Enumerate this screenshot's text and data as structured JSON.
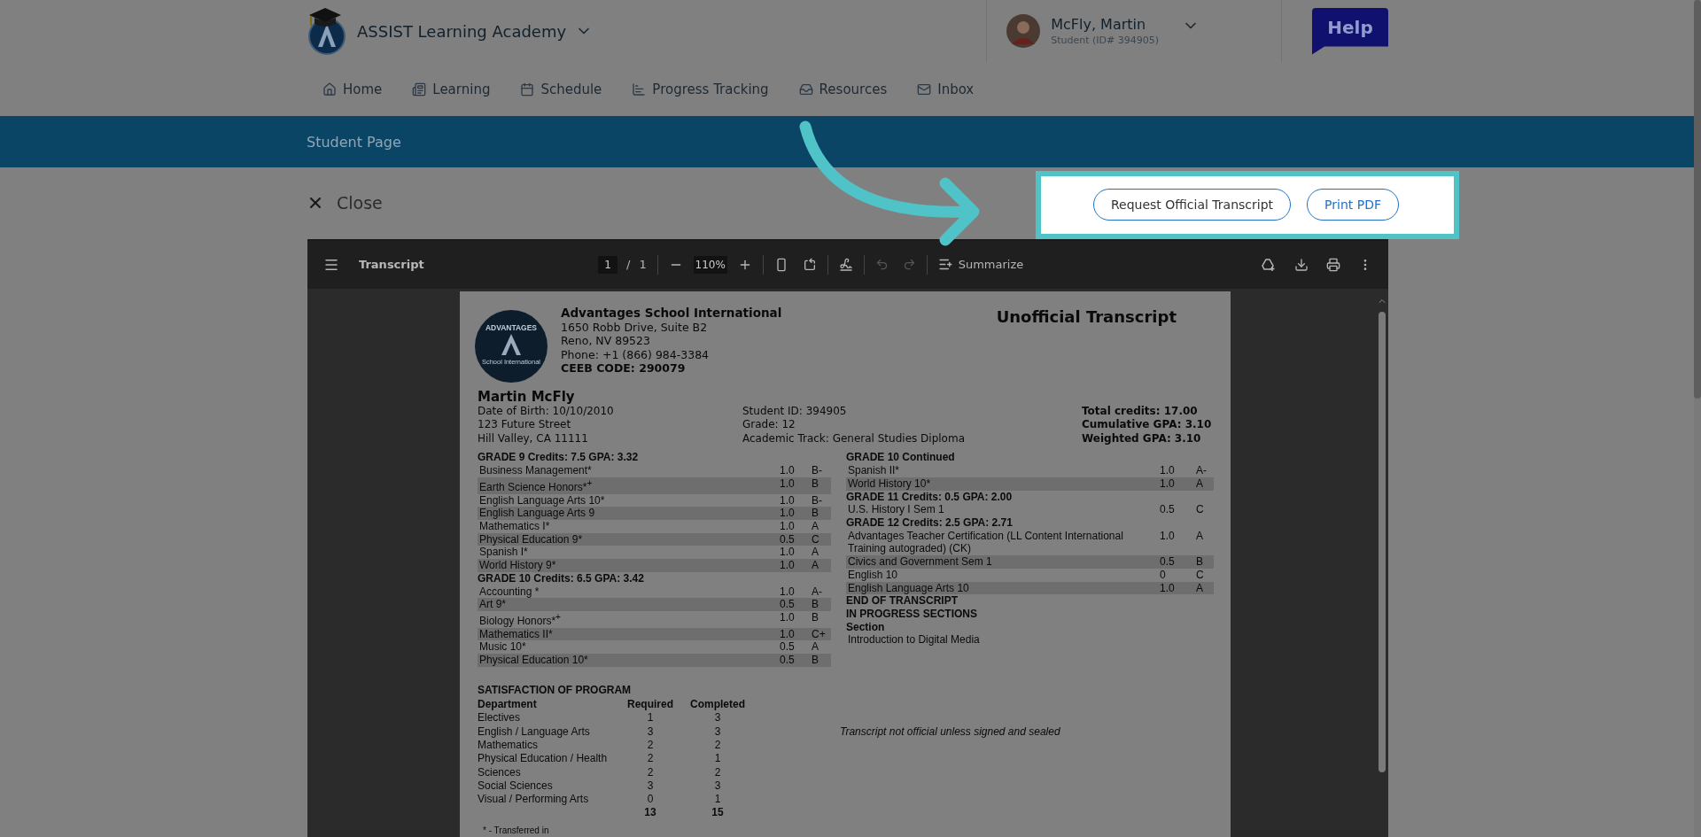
{
  "header": {
    "school": "ASSIST Learning Academy",
    "user": {
      "name": "McFly, Martin",
      "role": "Student (ID# 394905)"
    },
    "help": "Help"
  },
  "nav": [
    {
      "kind": "home",
      "label": "Home"
    },
    {
      "kind": "learning",
      "label": "Learning"
    },
    {
      "kind": "schedule",
      "label": "Schedule"
    },
    {
      "kind": "progress",
      "label": "Progress Tracking"
    },
    {
      "kind": "resources",
      "label": "Resources"
    },
    {
      "kind": "inbox",
      "label": "Inbox"
    }
  ],
  "banner": "Student Page",
  "close": "Close",
  "actions": [
    {
      "label": "Request Official Transcript",
      "primary": false
    },
    {
      "label": "Print PDF",
      "primary": true
    }
  ],
  "viewer": {
    "title": "Transcript",
    "page": "1",
    "separator": "/",
    "page_total": "1",
    "zoom": "110%",
    "summarize": "Summarize"
  },
  "document": {
    "seal": {
      "top": "ADVANTAGES",
      "bottom": "School International"
    },
    "school": {
      "name": "Advantages School International",
      "address": [
        "1650 Robb Drive, Suite B2",
        "Reno, NV 89523",
        "Phone: +1 (866) 984-3384"
      ],
      "code": "CEEB CODE: 290079"
    },
    "title": "Unofficial Transcript",
    "student": {
      "name": "Martin McFly",
      "details": [
        "Date of Birth: 10/10/2010",
        "123 Future Street",
        "Hill Valley, CA 11111"
      ],
      "ids": [
        "Student ID: 394905",
        "Grade: 12",
        "Academic Track: General Studies Diploma"
      ],
      "totals": [
        "Total credits: 17.00",
        "Cumulative GPA: 3.10",
        "Weighted GPA: 3.10"
      ]
    },
    "left_column": [
      {
        "kind": "heading",
        "text": "GRADE 9  Credits: 7.5  GPA: 3.32"
      },
      {
        "kind": "course",
        "name": "Business Management*",
        "credits": "1.0",
        "grade": "B-"
      },
      {
        "kind": "course",
        "name": "Earth Science Honors*$^{+}$",
        "credits": "1.0",
        "grade": "B"
      },
      {
        "kind": "course",
        "name": "English Language Arts 10*",
        "credits": "1.0",
        "grade": "B-"
      },
      {
        "kind": "course",
        "name": "English Language Arts 9",
        "credits": "1.0",
        "grade": "B"
      },
      {
        "kind": "course",
        "name": "Mathematics I*",
        "credits": "1.0",
        "grade": "A"
      },
      {
        "kind": "course",
        "name": "Physical Education 9*",
        "credits": "0.5",
        "grade": "C"
      },
      {
        "kind": "course",
        "name": "Spanish I*",
        "credits": "1.0",
        "grade": "A"
      },
      {
        "kind": "course",
        "name": "World History 9*",
        "credits": "1.0",
        "grade": "A"
      },
      {
        "kind": "heading",
        "text": "GRADE 10  Credits: 6.5  GPA: 3.42"
      },
      {
        "kind": "course",
        "name": "Accounting *",
        "credits": "1.0",
        "grade": "A-"
      },
      {
        "kind": "course",
        "name": "Art 9*",
        "credits": "0.5",
        "grade": "B"
      },
      {
        "kind": "course",
        "name": "Biology Honors*$^{+}$",
        "credits": "1.0",
        "grade": "B"
      },
      {
        "kind": "course",
        "name": "Mathematics II*",
        "credits": "1.0",
        "grade": "C+"
      },
      {
        "kind": "course",
        "name": "Music 10*",
        "credits": "0.5",
        "grade": "A"
      },
      {
        "kind": "course",
        "name": "Physical Education 10*",
        "credits": "0.5",
        "grade": "B"
      }
    ],
    "right_column": [
      {
        "kind": "heading",
        "text": "GRADE 10 Continued"
      },
      {
        "kind": "course",
        "name": "Spanish II*",
        "credits": "1.0",
        "grade": "A-"
      },
      {
        "kind": "course",
        "name": "World History 10*",
        "credits": "1.0",
        "grade": "A"
      },
      {
        "kind": "heading",
        "text": "GRADE 11  Credits: 0.5  GPA: 2.00"
      },
      {
        "kind": "course",
        "name": "U.S. History I Sem 1",
        "credits": "0.5",
        "grade": "C"
      },
      {
        "kind": "heading",
        "text": "GRADE 12  Credits: 2.5  GPA: 2.71"
      },
      {
        "kind": "course",
        "name": "Advantages Teacher Certification (LL Content International Training autograded) (CK)",
        "credits": "1.0",
        "grade": "A"
      },
      {
        "kind": "course",
        "name": "Civics and Government Sem 1",
        "credits": "0.5",
        "grade": "B"
      },
      {
        "kind": "course",
        "name": "English 10",
        "credits": "0",
        "grade": "C"
      },
      {
        "kind": "course",
        "name": "English Language Arts 10",
        "credits": "1.0",
        "grade": "A"
      },
      {
        "kind": "heading",
        "text": "END OF TRANSCRIPT"
      },
      {
        "kind": "heading",
        "text": "IN PROGRESS SECTIONS"
      },
      {
        "kind": "heading",
        "text": "Section"
      },
      {
        "kind": "plain",
        "text": "Introduction to Digital Media"
      }
    ],
    "satisfaction": {
      "title": "SATISFACTION OF PROGRAM",
      "columns": [
        "Department",
        "Required",
        "Completed"
      ],
      "rows": [
        [
          "Electives",
          "1",
          "3"
        ],
        [
          "English / Language Arts",
          "3",
          "3"
        ],
        [
          "Mathematics",
          "2",
          "2"
        ],
        [
          "Physical Education / Health",
          "2",
          "1"
        ],
        [
          "Sciences",
          "2",
          "2"
        ],
        [
          "Social Sciences",
          "3",
          "3"
        ],
        [
          "Visual / Performing Arts",
          "0",
          "1"
        ]
      ],
      "totals": [
        "13",
        "15"
      ]
    },
    "disclaimer": "Transcript not official unless signed and sealed",
    "footnote": "* - Transferred in"
  }
}
